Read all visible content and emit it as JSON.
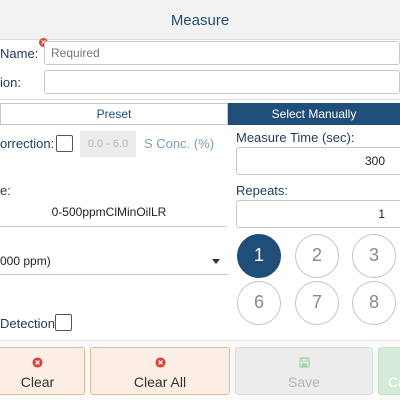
{
  "header": {
    "title": "Measure"
  },
  "form": {
    "name_label": "Name:",
    "name_placeholder": "Required",
    "description_label": "ion:",
    "description_value": ""
  },
  "mode_tabs": {
    "preset_label": "Preset",
    "manual_label": "Select Manually",
    "active": "manual"
  },
  "left_panel": {
    "correction_label": "orrection:",
    "correction_checked": false,
    "range_text": "0.0 - 6.0",
    "sconc_label": "S Conc. (%)",
    "curve_label": "e:",
    "curve_value": "0-500ppmClMinOilLR",
    "range_select_value": "000 ppm)",
    "detection_label": "Detection:",
    "detection_checked": false
  },
  "right_panel": {
    "measure_time_label": "Measure Time (sec):",
    "measure_time_value": "300",
    "repeats_label": "Repeats:",
    "repeats_value": "1",
    "repeat_buttons": [
      "1",
      "2",
      "3",
      "6",
      "7",
      "8"
    ],
    "selected_repeat": "1"
  },
  "footer": {
    "clear_label": "Clear",
    "clear_all_label": "Clear All",
    "save_label": "Save",
    "cancel_label": "Ca"
  },
  "colors": {
    "primary": "#1f4e79",
    "error_icon": "#e0403a",
    "clear_bg": "#fbeee4",
    "save_disabled_bg": "#ececec",
    "cancel_bg": "#d5ead9"
  },
  "icons": {
    "error": "error-circle-icon",
    "clear": "error-circle-icon",
    "save": "floppy-disk-icon",
    "dropdown": "caret-down-icon"
  }
}
